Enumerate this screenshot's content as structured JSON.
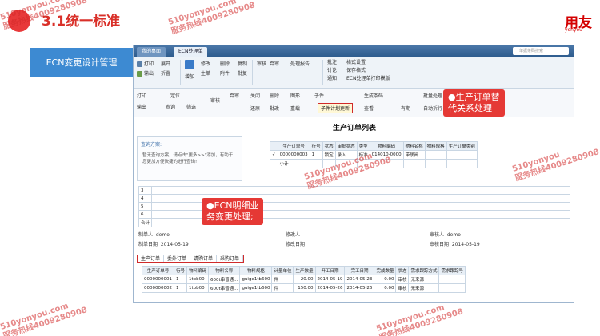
{
  "slide": {
    "title": "3.1统一标准",
    "section_label": "ECN变更设计管理",
    "logo": "用友",
    "logo_sub": "yonyou"
  },
  "watermark": {
    "text": "510yonyou.com\n服务热线4009280908",
    "text2": "510yonyou\n服务热线4009280908"
  },
  "app": {
    "tabs": [
      "我的桌面",
      "ECN处理单"
    ],
    "search_placeholder": "单据条码搜索",
    "ribbon1": [
      "打印",
      "输出",
      "展开",
      "折叠",
      "增加",
      "修改",
      "生单",
      "删除",
      "附件",
      "复制",
      "批复",
      "审核",
      "弃审",
      "处理报告",
      "批注",
      "讨论",
      "通知",
      "格式设置",
      "保存格式",
      "ECN处理单打印模版"
    ],
    "ribbon2": [
      "打印",
      "输出",
      "定位",
      "查询",
      "筛选",
      "审核",
      "弃审",
      "关闭",
      "删除",
      "图形",
      "子件",
      "还原",
      "批改",
      "重载",
      "子件计划更新",
      "生成条码",
      "查看",
      "有期",
      "批量处理",
      "自动拆行"
    ],
    "list_title": "生产订单列表",
    "query": {
      "title": "查询方案:",
      "hint": "暂无查询方案，请点击\"更多>>\"添加，有助于您更加方便快捷的进行查询!"
    },
    "grid1": {
      "headers": [
        "",
        "生产订单号",
        "行号",
        "状态",
        "审批状态",
        "类型",
        "物料编码",
        "物料名称",
        "物料规格",
        "生产订单类别"
      ],
      "rows": [
        [
          "✓",
          "0000000003",
          "1",
          "锁定",
          "录入",
          "标准",
          "014010-0000",
          "带联阀",
          "",
          ""
        ]
      ],
      "subtotal": "小计"
    },
    "left_rows": [
      "3",
      "4",
      "5",
      "6",
      "合计"
    ],
    "info": {
      "maker_label": "制单人",
      "maker": "demo",
      "date_label": "制单日期",
      "date": "2014-05-19",
      "modifier_label": "修改人",
      "modify_date_label": "修改日期",
      "auditor_label": "审核人",
      "auditor": "demo",
      "audit_date_label": "审核日期",
      "audit_date": "2014-05-19"
    },
    "subtabs": [
      "生产订单",
      "委外订单",
      "请购订单",
      "采购订单"
    ],
    "grid2": {
      "headers": [
        "生产订单号",
        "行号",
        "物料编码",
        "物料名称",
        "物料规格",
        "计量单位",
        "生产数量",
        "开工日期",
        "完工日期",
        "完成数量",
        "状态",
        "需求跟踪方式",
        "需求跟踪号"
      ],
      "rows": [
        [
          "0000000001",
          "1",
          "1tbb00",
          "600t串普通...",
          "guige1tb600",
          "件",
          "20.00",
          "2014-05-19",
          "2014-05-23",
          "0.00",
          "审核",
          "无来源",
          ""
        ],
        [
          "0000000002",
          "1",
          "1tbb00",
          "600t串普通...",
          "guige1tb600",
          "件",
          "150.00",
          "2014-05-26",
          "2014-05-26",
          "0.00",
          "审核",
          "无来源",
          ""
        ]
      ]
    }
  },
  "callouts": {
    "c1": "●生产订单替\n代关系处理",
    "c2": "●ECN明细业\n务变更处理;"
  },
  "colors": {
    "accent": "#d93029",
    "blue": "#3d8ad2",
    "callout": "#e53935"
  }
}
